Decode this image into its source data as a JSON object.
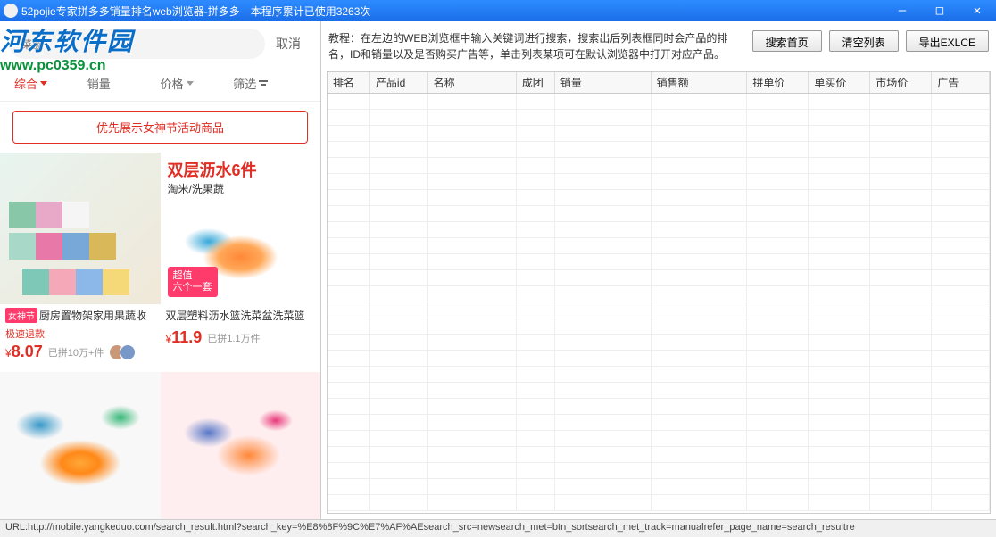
{
  "window": {
    "title": "52pojie专家拼多多销量排名web浏览器-拼多多　本程序累计已使用3263次"
  },
  "watermark": {
    "text": "河东软件园",
    "url": "www.pc0359.cn"
  },
  "search": {
    "placeholder": "菜篮",
    "cancel": "取消"
  },
  "tabs": {
    "comprehensive": "综合",
    "sales": "销量",
    "price": "价格",
    "filter": "筛选"
  },
  "promo_banner": "优先展示女神节活动商品",
  "products": [
    {
      "badge": "女神节",
      "title": "厨房置物架家用果蔬收",
      "refund": "极速退款",
      "currency": "¥",
      "price": "8.07",
      "sold": "已拼10万+件",
      "has_avatars": true
    },
    {
      "promo_title": "双层沥水6件",
      "promo_sub": "淘米/洗果蔬",
      "value_badge_l1": "超值",
      "value_badge_l2": "六个一套",
      "title": "双层塑料沥水篮洗菜盆洗菜篮",
      "currency": "¥",
      "price": "11.9",
      "sold": "已拼1.1万件"
    }
  ],
  "instruction": "教程：在左边的WEB浏览框中输入关键词进行搜索，搜索出后列表框同时会产品的排名，ID和销量以及是否购买广告等，单击列表某项可在默认浏览器中打开对应产品。",
  "buttons": {
    "search_home": "搜索首页",
    "clear_list": "清空列表",
    "export": "导出EXLCE"
  },
  "table_headers": {
    "rank": "排名",
    "product_id": "产品id",
    "name": "名称",
    "group": "成团",
    "sales": "销量",
    "revenue": "销售额",
    "group_price": "拼单价",
    "single_price": "单买价",
    "market_price": "市场价",
    "ad": "广告"
  },
  "status_bar": "URL:http://mobile.yangkeduo.com/search_result.html?search_key=%E8%8F%9C%E7%AF%AEsearch_src=newsearch_met=btn_sortsearch_met_track=manualrefer_page_name=search_resultre"
}
